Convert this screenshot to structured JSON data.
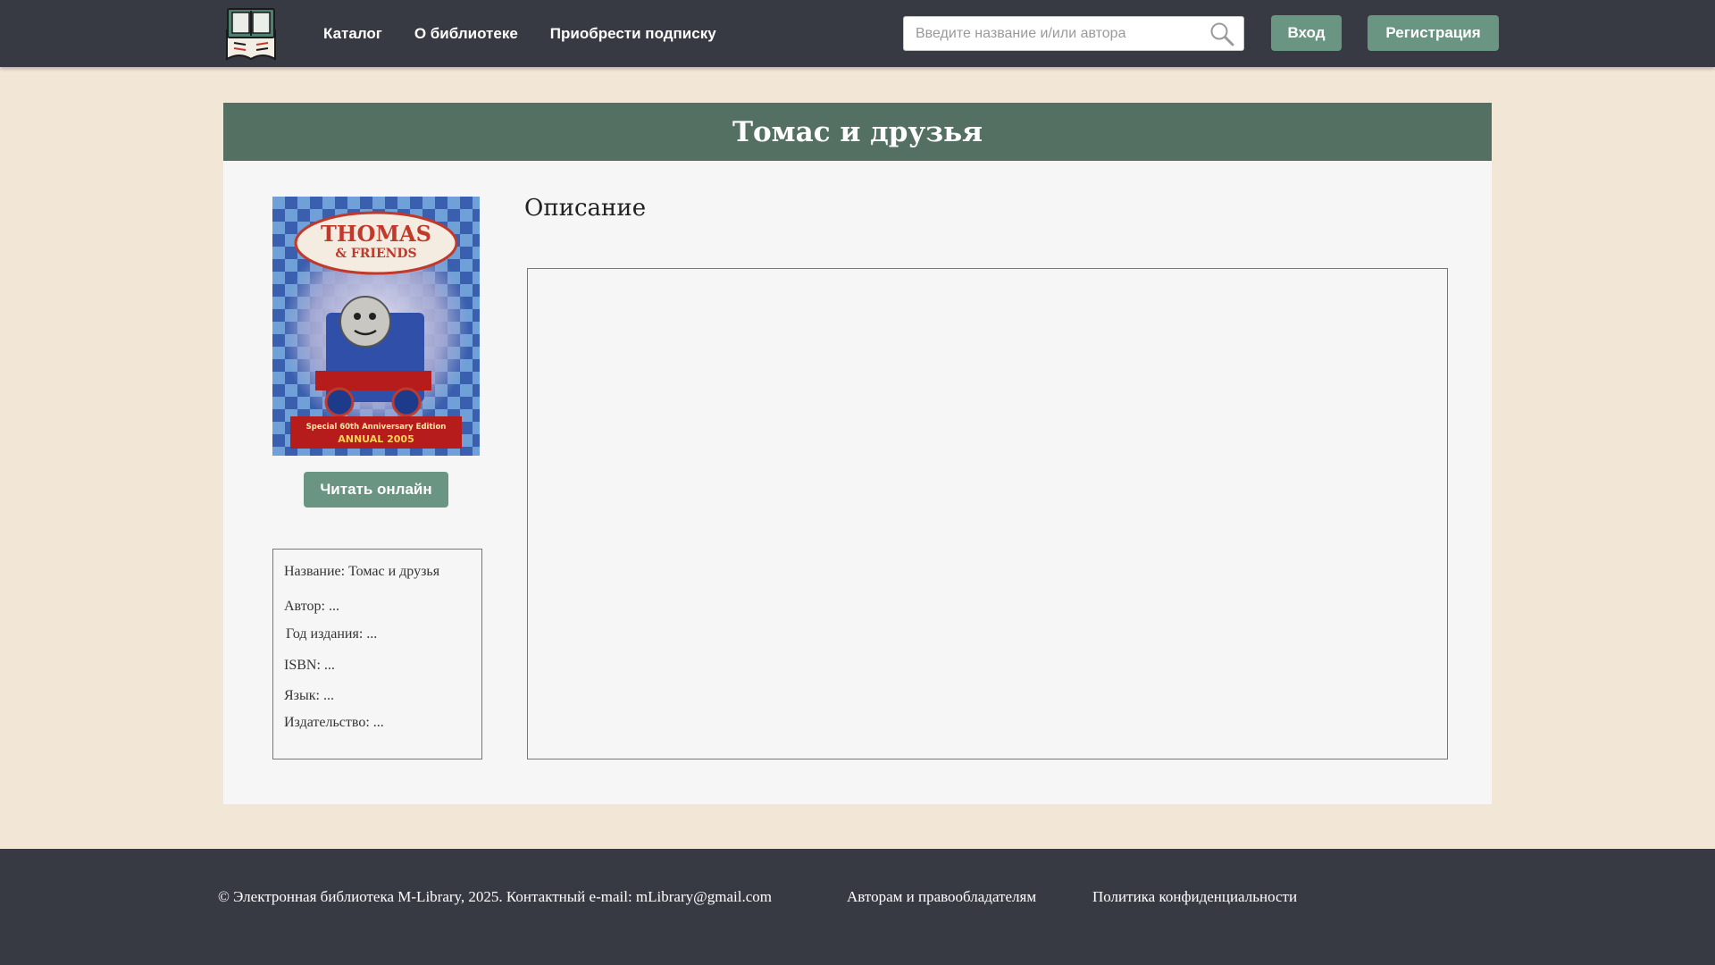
{
  "header": {
    "nav": [
      "Каталог",
      "О библиотеке",
      "Приобрести подписку"
    ],
    "search_placeholder": "Введите название и/или автора",
    "login_label": "Вход",
    "register_label": "Регистрация"
  },
  "book": {
    "title": "Томас и друзья",
    "cover_image": {
      "brand": "THOMAS",
      "brand_sub": "& FRIENDS",
      "edition": "Special 60th Anniversary Edition",
      "annual": "ANNUAL 2005"
    },
    "read_online_label": "Читать онлайн",
    "info": {
      "name": "Название: Томас и друзья",
      "author": "Автор: ...",
      "year": "Год издания: ...",
      "isbn": "ISBN: ...",
      "language": "Язык: ...",
      "publisher": "Издательство: ..."
    },
    "description_title": "Описание"
  },
  "footer": {
    "copyright": "© Электронная библиотека M-Library, 2025. Контактный e-mail: mLibrary@gmail.com",
    "authors_link": "Авторам и правообладателям",
    "privacy_link": "Политика конфиденциальности"
  },
  "colors": {
    "header_bg": "#373a42",
    "page_bg": "#f2e6d6",
    "accent": "#6a9582",
    "title_bar": "#537063"
  }
}
